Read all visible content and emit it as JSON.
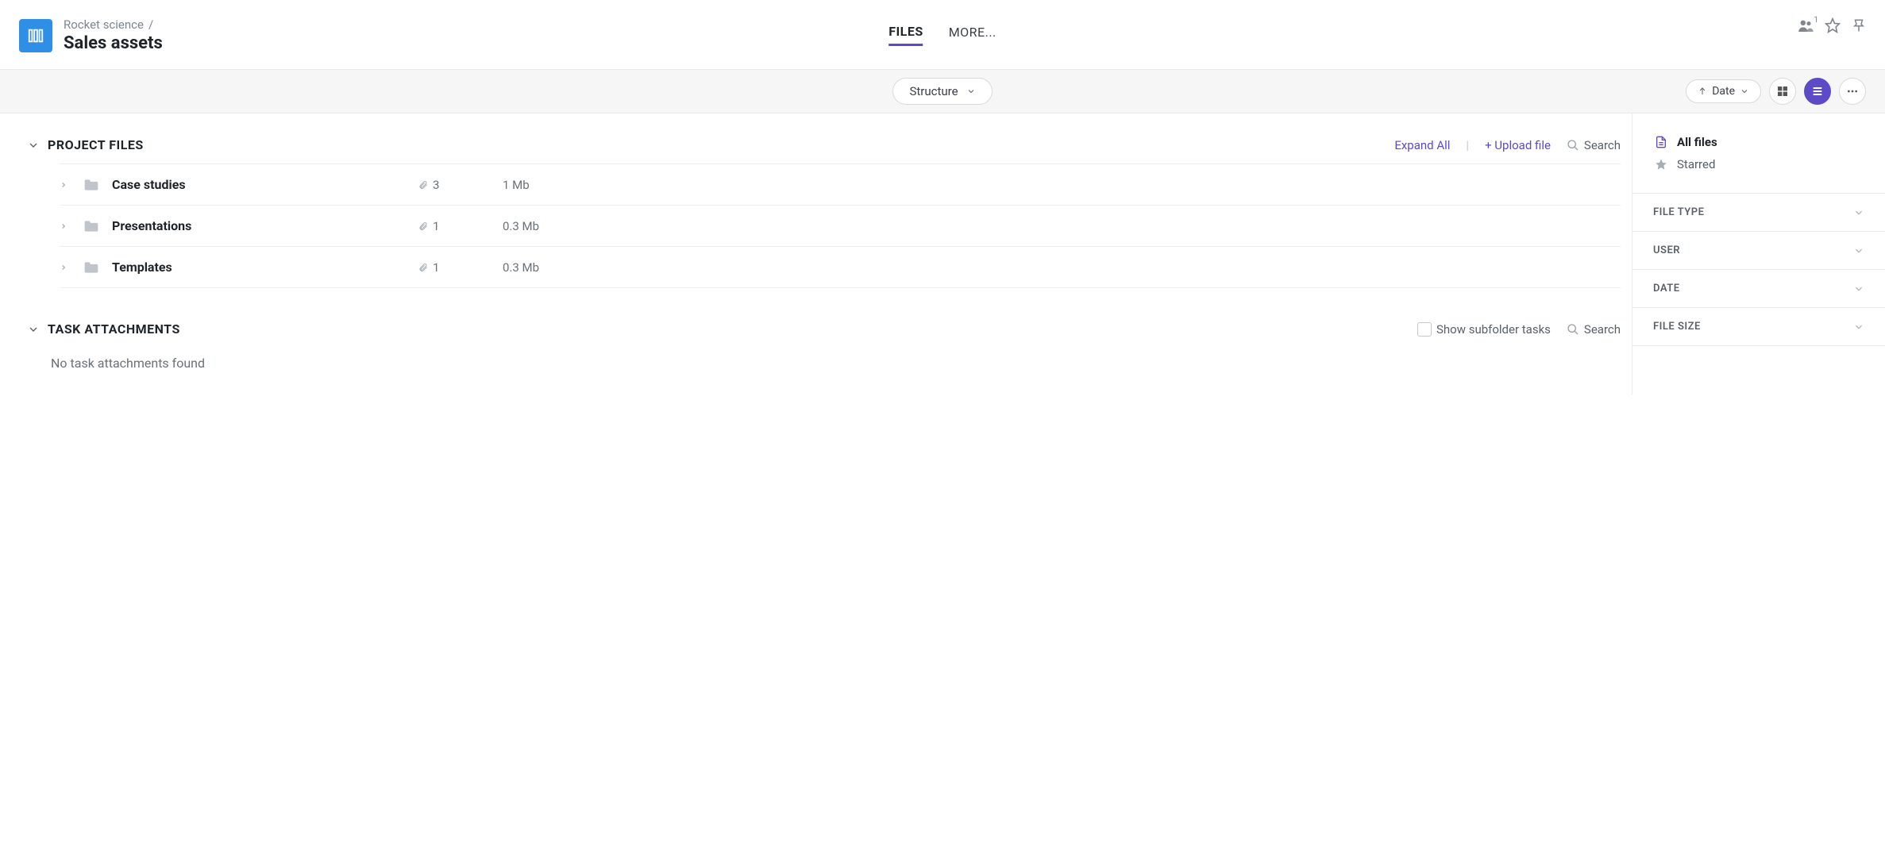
{
  "breadcrumb": {
    "parent": "Rocket science",
    "separator": "/"
  },
  "title": "Sales assets",
  "tabs": {
    "files": "FILES",
    "more": "MORE..."
  },
  "share_count": "1",
  "toolbar": {
    "structure_label": "Structure",
    "sort_label": "Date"
  },
  "project_files": {
    "heading": "PROJECT FILES",
    "expand_all": "Expand All",
    "upload": "+ Upload file",
    "search": "Search",
    "rows": [
      {
        "name": "Case studies",
        "count": "3",
        "size": "1 Mb"
      },
      {
        "name": "Presentations",
        "count": "1",
        "size": "0.3 Mb"
      },
      {
        "name": "Templates",
        "count": "1",
        "size": "0.3 Mb"
      }
    ]
  },
  "task_attachments": {
    "heading": "TASK ATTACHMENTS",
    "show_subfolder": "Show subfolder tasks",
    "search": "Search",
    "empty": "No task attachments found"
  },
  "sidebar": {
    "all_files": "All files",
    "starred": "Starred",
    "filters": {
      "file_type": "FILE TYPE",
      "user": "USER",
      "date": "DATE",
      "file_size": "FILE SIZE"
    }
  }
}
